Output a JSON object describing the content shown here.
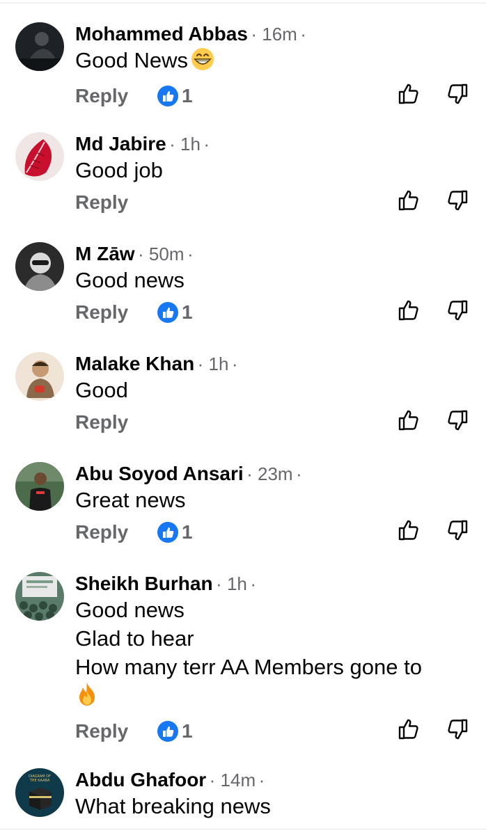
{
  "comments": [
    {
      "name": "Mohammed Abbas",
      "time": "16m",
      "lines": [
        "Good News"
      ],
      "emoji": "grinning-face",
      "reply": "Reply",
      "likes": "1",
      "avatar": {
        "bg": "#1e2226",
        "fg": "#4a4f55"
      }
    },
    {
      "name": "Md Jabire",
      "time": "1h",
      "lines": [
        "Good job"
      ],
      "reply": "Reply",
      "avatar": {
        "bg": "#f1e6e6",
        "fg": "#c8102e"
      }
    },
    {
      "name": "M Zāw",
      "time": "50m",
      "lines": [
        "Good news"
      ],
      "reply": "Reply",
      "likes": "1",
      "avatar": {
        "bg": "#2b2b2b",
        "fg": "#d9d9d9"
      }
    },
    {
      "name": "Malake Khan",
      "time": "1h",
      "lines": [
        "Good"
      ],
      "reply": "Reply",
      "avatar": {
        "bg": "#efe4d6",
        "fg": "#8a6a4a"
      }
    },
    {
      "name": "Abu Soyod Ansari",
      "time": "23m",
      "lines": [
        "Great news"
      ],
      "reply": "Reply",
      "likes": "1",
      "avatar": {
        "bg": "#4c6b4a",
        "fg": "#1a1a1a"
      }
    },
    {
      "name": "Sheikh Burhan",
      "time": "1h",
      "lines": [
        "Good news",
        "Glad to hear",
        "How many terr AA Members gone to"
      ],
      "emoji_line": "fire",
      "reply": "Reply",
      "likes": "1",
      "avatar": {
        "bg": "#5a7a6a",
        "fg": "#e8e8e8"
      }
    },
    {
      "name": "Abdu Ghafoor",
      "time": "14m",
      "lines": [
        "What breaking news"
      ],
      "avatar": {
        "bg": "#0f3a4a",
        "fg": "#d8c470",
        "caption": "DIAGRAM OF THE KAABA"
      }
    }
  ],
  "colors": {
    "like_blue": "#1877f2",
    "secondary_text": "#65676b",
    "primary_text": "#050505"
  }
}
